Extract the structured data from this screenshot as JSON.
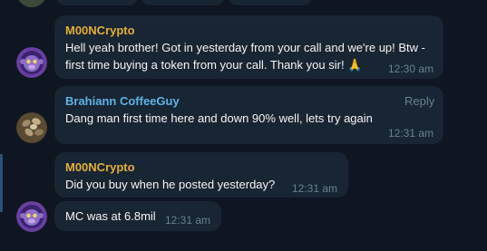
{
  "messages": [
    {
      "sender": "M00NCrypto",
      "sender_color": "#e4ae3a",
      "lines": [
        "Hell yeah brother! Got in yesterday from your call and we're up! Btw -",
        "first time buying a token from your call. Thank you sir! 🙏"
      ],
      "time": "12:30 am"
    },
    {
      "sender": "Brahiann CoffeeGuy",
      "sender_color": "#5fb3e6",
      "action": "Reply",
      "lines": [
        "Dang man first time here and down 90% well, lets try again"
      ],
      "time": "12:31 am"
    },
    {
      "sender": "M00NCrypto",
      "sender_color": "#e4ae3a",
      "lines": [
        "Did you buy when he posted yesterday?"
      ],
      "time": "12:31 am"
    },
    {
      "lines": [
        "MC was at 6.8mil"
      ],
      "time": "12:31 am"
    }
  ],
  "icons": {
    "avatar_moon": "monkey-avatar-icon",
    "avatar_brahiann": "coffee-beans-avatar-icon",
    "reaction": "folded-hands-emoji"
  }
}
